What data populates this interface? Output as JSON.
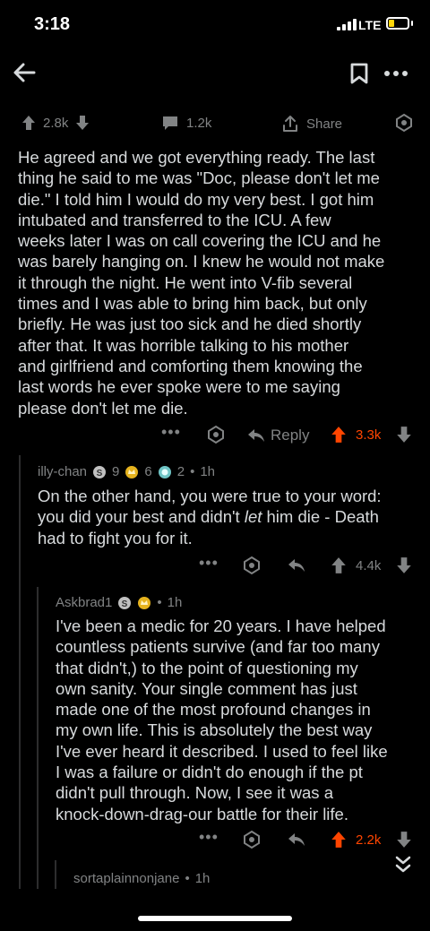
{
  "status": {
    "time": "3:18",
    "network": "LTE"
  },
  "header": {
    "back_icon": "arrow-left-icon",
    "save_icon": "bookmark-icon",
    "more_icon": "more-horizontal-icon"
  },
  "post_actions": {
    "upvotes": "2.8k",
    "comments": "1.2k",
    "share_label": "Share"
  },
  "comment_main": {
    "text": "He agreed and we got everything ready.  The last\nthing he said to me was \"Doc, please don't let me\ndie.\"  I told him I would do my very best.  I got him\nintubated and transferred to the ICU.  A few\nweeks later I was on call covering the ICU and he\nwas barely hanging on.  I knew he would not make\nit through the night.  He went into V-fib several\ntimes and I was able to bring him back, but only\nbriefly.  He was just too sick and he died shortly\nafter that.  It was horrible talking to his mother\nand girlfriend and comforting them knowing the\nlast words he ever spoke were to me saying\nplease don't let me die.",
    "reply_label": "Reply",
    "score": "3.3k"
  },
  "reply1": {
    "author": "illy-chan",
    "award1_count": "9",
    "award2_count": "6",
    "award3_count": "2",
    "time": "1h",
    "text_part1": "On the other hand, you were true to your word:\nyou did your best and didn't ",
    "text_italic": "let",
    "text_part2": " him die - Death\nhad to fight you for it.",
    "score": "4.4k"
  },
  "reply2": {
    "author": "Askbrad1",
    "time": "1h",
    "text": "I've been a medic for 20 years. I have helped\ncountless patients survive (and far too many\nthat didn't,) to the point of questioning my\nown sanity. Your single comment has just\nmade one of the most profound changes in\nmy own life. This is absolutely the best way\nI've ever heard it described. I used to feel like\nI was a failure or didn't do enough if the pt\ndidn't pull through.  Now, I see it was a\nknock-down-drag-our battle for their life.",
    "score": "2.2k"
  },
  "reply3": {
    "author": "sortaplainnonjane",
    "time": "1h"
  },
  "colors": {
    "background": "#000000",
    "text": "#d7dadc",
    "muted": "#818384",
    "upvote": "#ff4500"
  }
}
